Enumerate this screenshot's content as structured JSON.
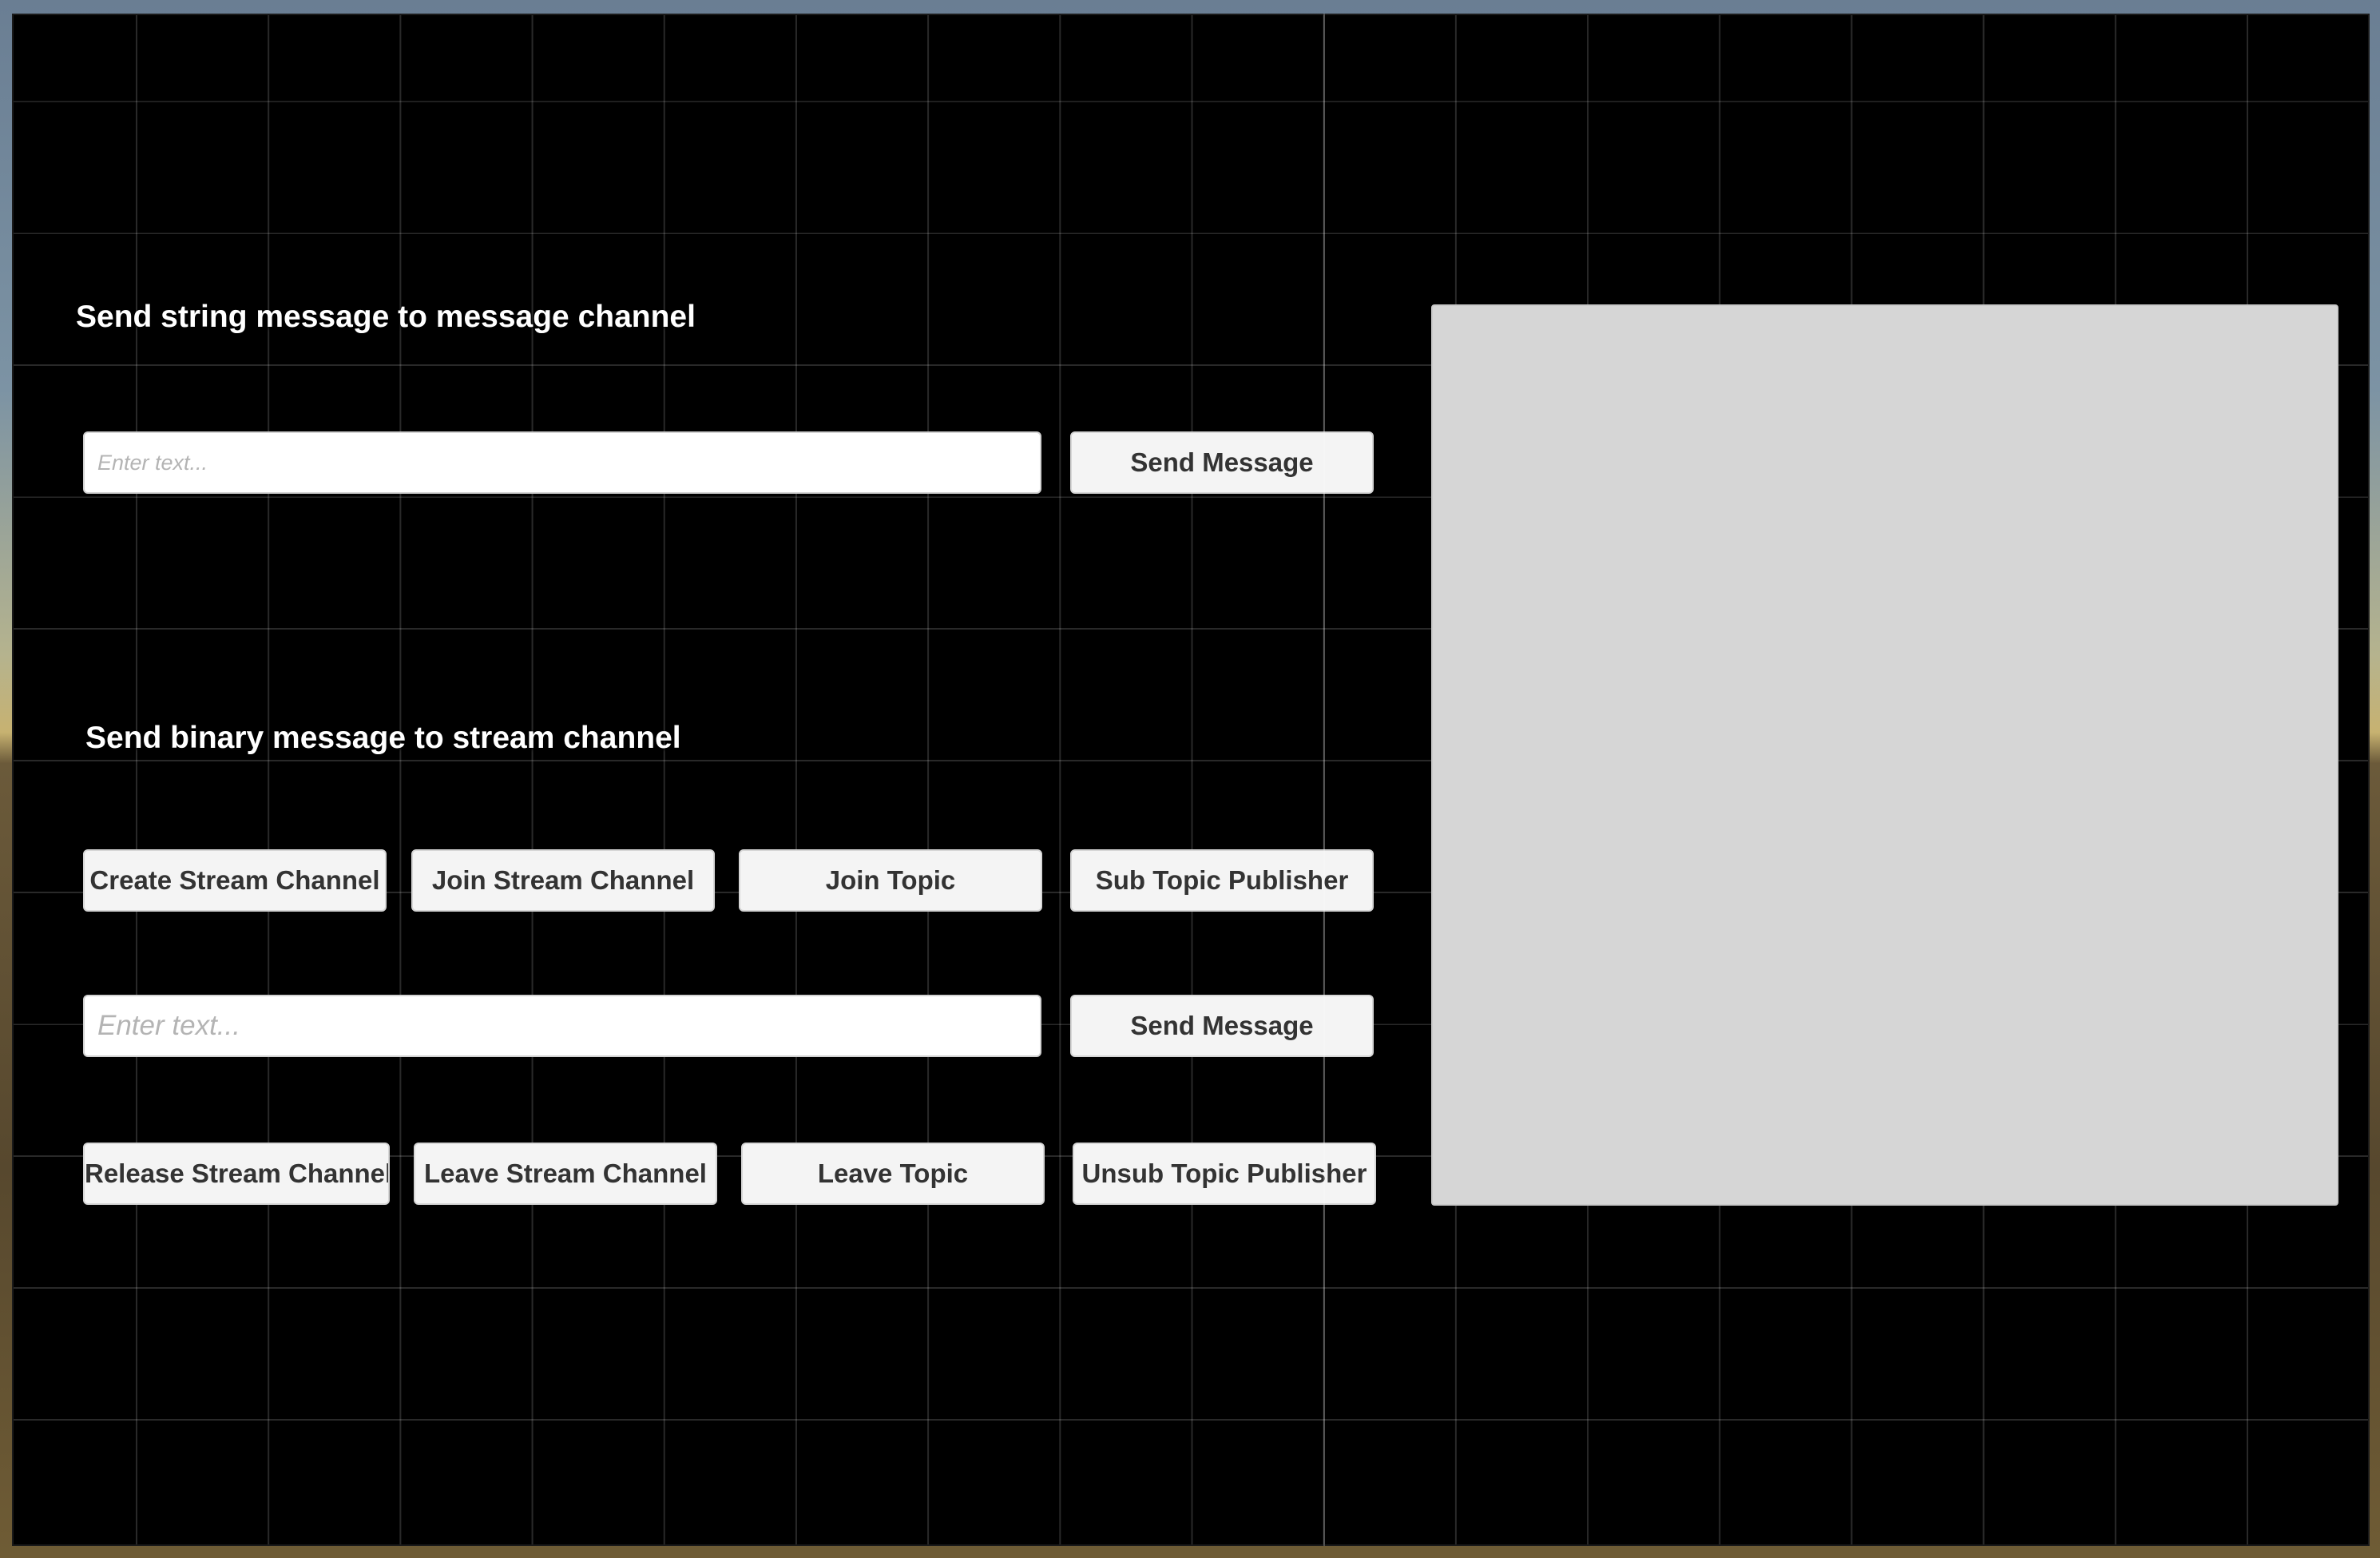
{
  "string_section": {
    "title": "Send string message to message channel",
    "input_placeholder": "Enter text...",
    "send_label": "Send Message"
  },
  "stream_section": {
    "title": "Send binary message to stream channel",
    "row1": {
      "create_label": "Create Stream Channel",
      "join_label": "Join Stream Channel",
      "join_topic_label": "Join Topic",
      "sub_label": "Sub Topic Publisher"
    },
    "input_placeholder": "Enter text...",
    "send_label": "Send Message",
    "row3": {
      "release_label": "Release Stream Channel",
      "leave_label": "Leave Stream Channel",
      "leave_topic_label": "Leave Topic",
      "unsub_label": "Unsub Topic Publisher"
    }
  },
  "display": {}
}
